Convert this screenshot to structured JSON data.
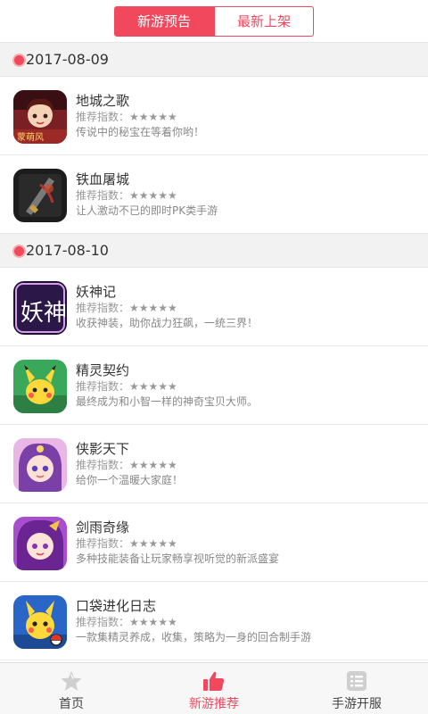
{
  "colors": {
    "accent": "#f2485e",
    "inactive_icon": "#cfcfcf"
  },
  "segments": {
    "active_label": "新游预告",
    "inactive_label": "最新上架"
  },
  "groups": [
    {
      "date": "2017-08-09",
      "games": [
        {
          "name": "地城之歌",
          "rating_label": "推荐指数：",
          "stars": "★★★★★",
          "desc": "传说中的秘宝在等着你哟！",
          "icon": "game-icon-dicheng",
          "icon_caption": "蒙萌风"
        },
        {
          "name": "铁血屠城",
          "rating_label": "推荐指数：",
          "stars": "★★★★★",
          "desc": "让人激动不已的即时PK类手游",
          "icon": "game-icon-tiexue"
        }
      ]
    },
    {
      "date": "2017-08-10",
      "games": [
        {
          "name": "妖神记",
          "rating_label": "推荐指数：",
          "stars": "★★★★★",
          "desc": "收获神装，助你战力狂飙，一统三界！",
          "icon": "game-icon-yaoshenji",
          "icon_caption": "妖神"
        },
        {
          "name": "精灵契约",
          "rating_label": "推荐指数：",
          "stars": "★★★★★",
          "desc": "最终成为和小智一样的神奇宝贝大师。",
          "icon": "game-icon-jingling"
        },
        {
          "name": "侠影天下",
          "rating_label": "推荐指数：",
          "stars": "★★★★★",
          "desc": "给你一个温暖大家庭！",
          "icon": "game-icon-xiaying"
        },
        {
          "name": "剑雨奇缘",
          "rating_label": "推荐指数：",
          "stars": "★★★★★",
          "desc": "多种技能装备让玩家畅享视听觉的新派盛宴",
          "icon": "game-icon-jianyu"
        },
        {
          "name": "口袋进化日志",
          "rating_label": "推荐指数：",
          "stars": "★★★★★",
          "desc": "一款集精灵养成，收集，策略为一身的回合制手游",
          "icon": "game-icon-koudai"
        }
      ]
    }
  ],
  "tabs": [
    {
      "label": "首页",
      "icon": "star-icon",
      "active": false
    },
    {
      "label": "新游推荐",
      "icon": "thumbs-up-icon",
      "active": true
    },
    {
      "label": "手游开服",
      "icon": "list-icon",
      "active": false
    }
  ]
}
